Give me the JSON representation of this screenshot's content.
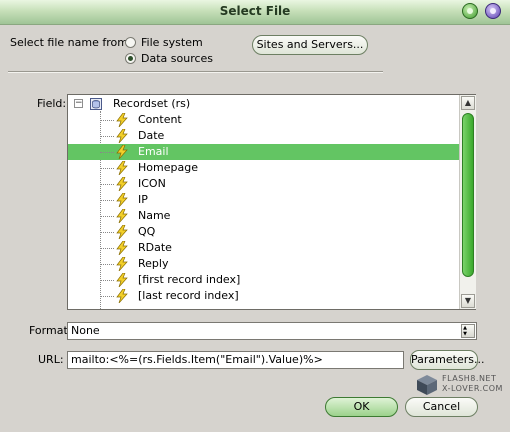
{
  "window": {
    "title": "Select File"
  },
  "source": {
    "label": "Select file name from:",
    "options": [
      {
        "label": "File system",
        "selected": false
      },
      {
        "label": "Data sources",
        "selected": true
      }
    ],
    "sites_button": "Sites and Servers..."
  },
  "field": {
    "label": "Field:",
    "root": {
      "label": "Recordset (rs)",
      "expander": "−"
    },
    "items": [
      {
        "label": "Content"
      },
      {
        "label": "Date"
      },
      {
        "label": "Email",
        "selected": true
      },
      {
        "label": "Homepage"
      },
      {
        "label": "ICON"
      },
      {
        "label": "IP"
      },
      {
        "label": "Name"
      },
      {
        "label": "QQ"
      },
      {
        "label": "RDate"
      },
      {
        "label": "Reply"
      },
      {
        "label": "[first record index]"
      },
      {
        "label": "[last record index]"
      }
    ],
    "selection_color": "#63c563"
  },
  "format": {
    "label": "Format:",
    "value": "None"
  },
  "url": {
    "label": "URL:",
    "value": "mailto:<%=(rs.Fields.Item(\"Email\").Value)%>",
    "parameters_button": "Parameters..."
  },
  "buttons": {
    "ok": "OK",
    "cancel": "Cancel"
  },
  "watermark": {
    "line1": "FLASH8.NET",
    "line2": "X-LOVER.COM"
  },
  "icons": {
    "close": "close-icon",
    "minimize": "minimize-icon",
    "recordset": "database-icon",
    "field": "lightning-bolt-icon"
  }
}
